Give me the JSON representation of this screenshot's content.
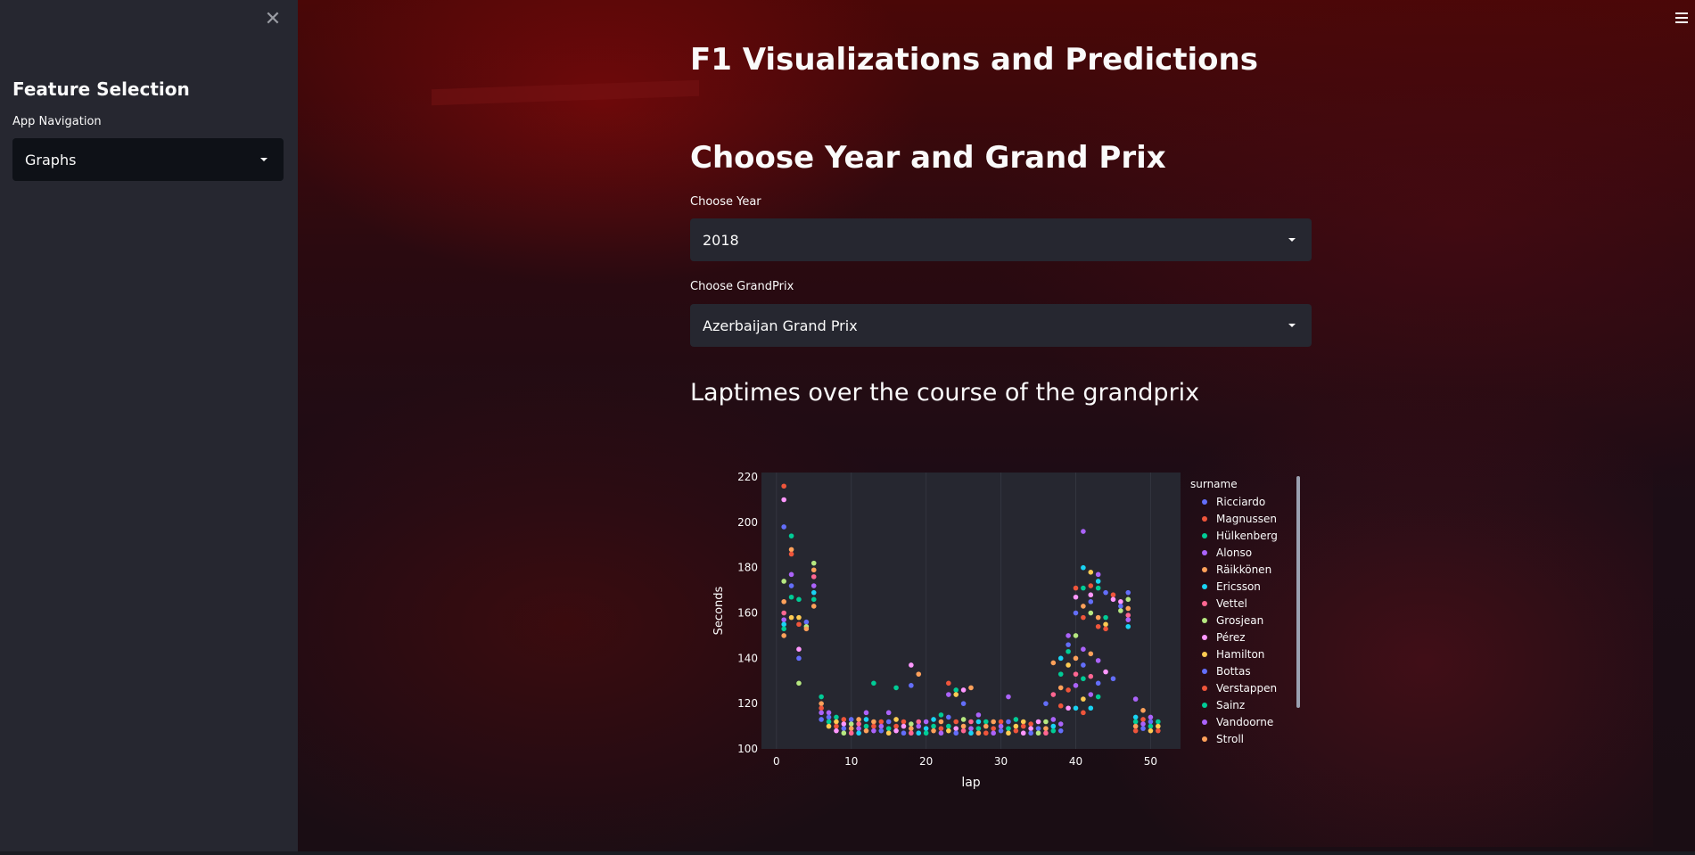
{
  "sidebar": {
    "close_icon": "close-icon",
    "title": "Feature Selection",
    "nav_label": "App Navigation",
    "nav_value": "Graphs"
  },
  "main": {
    "title": "F1 Visualizations and Predictions",
    "section_title": "Choose Year and Grand Prix",
    "year_label": "Choose Year",
    "year_value": "2018",
    "gp_label": "Choose GrandPrix",
    "gp_value": "Azerbaijan Grand Prix",
    "chart_heading": "Laptimes over the course of the grandprix",
    "menu_icon": "hamburger-menu-icon"
  },
  "colors": {
    "sidebar_bg": "#262730",
    "select_bg": "#262730",
    "plot_bg": "#262730"
  },
  "chart_data": {
    "type": "scatter",
    "xlabel": "lap",
    "ylabel": "Seconds",
    "xlim": [
      -2,
      54
    ],
    "ylim": [
      100,
      222
    ],
    "x_ticks": [
      0,
      10,
      20,
      30,
      40,
      50
    ],
    "y_ticks": [
      100,
      120,
      140,
      160,
      180,
      200,
      220
    ],
    "legend_title": "surname",
    "legend_position": "right",
    "series": [
      {
        "name": "Ricciardo",
        "color": "#636efa"
      },
      {
        "name": "Magnussen",
        "color": "#ef553b"
      },
      {
        "name": "Hülkenberg",
        "color": "#00cc96"
      },
      {
        "name": "Alonso",
        "color": "#ab63fa"
      },
      {
        "name": "Räikkönen",
        "color": "#ffa15a"
      },
      {
        "name": "Ericsson",
        "color": "#19d3f3"
      },
      {
        "name": "Vettel",
        "color": "#ff6692"
      },
      {
        "name": "Grosjean",
        "color": "#b6e880"
      },
      {
        "name": "Pérez",
        "color": "#ff97ff"
      },
      {
        "name": "Hamilton",
        "color": "#fecb52"
      },
      {
        "name": "Bottas",
        "color": "#636efa"
      },
      {
        "name": "Verstappen",
        "color": "#ef553b"
      },
      {
        "name": "Sainz",
        "color": "#00cc96"
      },
      {
        "name": "Vandoorne",
        "color": "#ab63fa"
      },
      {
        "name": "Stroll",
        "color": "#ffa15a"
      }
    ],
    "points": [
      [
        1,
        216
      ],
      [
        1,
        210
      ],
      [
        1,
        198
      ],
      [
        1,
        174
      ],
      [
        1,
        165
      ],
      [
        1,
        160
      ],
      [
        1,
        157
      ],
      [
        1,
        155
      ],
      [
        1,
        153
      ],
      [
        1,
        150
      ],
      [
        2,
        194
      ],
      [
        2,
        188
      ],
      [
        2,
        186
      ],
      [
        2,
        177
      ],
      [
        2,
        172
      ],
      [
        2,
        167
      ],
      [
        2,
        158
      ],
      [
        3,
        166
      ],
      [
        3,
        158
      ],
      [
        3,
        155
      ],
      [
        3,
        144
      ],
      [
        3,
        140
      ],
      [
        3,
        129
      ],
      [
        4,
        156
      ],
      [
        4,
        154
      ],
      [
        4,
        153
      ],
      [
        5,
        182
      ],
      [
        5,
        179
      ],
      [
        5,
        176
      ],
      [
        5,
        172
      ],
      [
        5,
        169
      ],
      [
        5,
        166
      ],
      [
        5,
        163
      ],
      [
        6,
        123
      ],
      [
        6,
        120
      ],
      [
        6,
        118
      ],
      [
        6,
        116
      ],
      [
        6,
        113
      ],
      [
        7,
        116
      ],
      [
        7,
        114
      ],
      [
        7,
        112
      ],
      [
        7,
        110
      ],
      [
        8,
        114
      ],
      [
        8,
        112
      ],
      [
        8,
        110
      ],
      [
        8,
        108
      ],
      [
        9,
        113
      ],
      [
        9,
        111
      ],
      [
        9,
        109
      ],
      [
        9,
        107
      ],
      [
        10,
        113
      ],
      [
        10,
        111
      ],
      [
        10,
        109
      ],
      [
        10,
        107
      ],
      [
        11,
        113
      ],
      [
        11,
        111
      ],
      [
        11,
        109
      ],
      [
        11,
        107
      ],
      [
        12,
        116
      ],
      [
        12,
        113
      ],
      [
        12,
        110
      ],
      [
        12,
        108
      ],
      [
        13,
        129
      ],
      [
        13,
        112
      ],
      [
        13,
        110
      ],
      [
        13,
        108
      ],
      [
        14,
        112
      ],
      [
        14,
        110
      ],
      [
        14,
        108
      ],
      [
        15,
        116
      ],
      [
        15,
        112
      ],
      [
        15,
        109
      ],
      [
        15,
        107
      ],
      [
        16,
        127
      ],
      [
        16,
        113
      ],
      [
        16,
        110
      ],
      [
        16,
        108
      ],
      [
        17,
        112
      ],
      [
        17,
        110
      ],
      [
        17,
        107
      ],
      [
        18,
        137
      ],
      [
        18,
        128
      ],
      [
        18,
        111
      ],
      [
        18,
        109
      ],
      [
        18,
        107
      ],
      [
        19,
        133
      ],
      [
        19,
        112
      ],
      [
        19,
        110
      ],
      [
        19,
        107
      ],
      [
        20,
        112
      ],
      [
        20,
        109
      ],
      [
        20,
        107
      ],
      [
        21,
        113
      ],
      [
        21,
        110
      ],
      [
        21,
        108
      ],
      [
        22,
        115
      ],
      [
        22,
        112
      ],
      [
        22,
        109
      ],
      [
        22,
        107
      ],
      [
        23,
        129
      ],
      [
        23,
        124
      ],
      [
        23,
        114
      ],
      [
        23,
        110
      ],
      [
        23,
        108
      ],
      [
        24,
        126
      ],
      [
        24,
        124
      ],
      [
        24,
        112
      ],
      [
        24,
        109
      ],
      [
        24,
        107
      ],
      [
        25,
        126
      ],
      [
        25,
        120
      ],
      [
        25,
        113
      ],
      [
        25,
        110
      ],
      [
        25,
        108
      ],
      [
        26,
        127
      ],
      [
        26,
        112
      ],
      [
        26,
        109
      ],
      [
        26,
        107
      ],
      [
        27,
        115
      ],
      [
        27,
        112
      ],
      [
        27,
        109
      ],
      [
        27,
        107
      ],
      [
        28,
        112
      ],
      [
        28,
        110
      ],
      [
        28,
        107
      ],
      [
        29,
        112
      ],
      [
        29,
        109
      ],
      [
        29,
        107
      ],
      [
        30,
        112
      ],
      [
        30,
        110
      ],
      [
        30,
        108
      ],
      [
        31,
        123
      ],
      [
        31,
        112
      ],
      [
        31,
        109
      ],
      [
        31,
        107
      ],
      [
        32,
        113
      ],
      [
        32,
        110
      ],
      [
        32,
        108
      ],
      [
        33,
        112
      ],
      [
        33,
        110
      ],
      [
        33,
        107
      ],
      [
        34,
        111
      ],
      [
        34,
        109
      ],
      [
        34,
        107
      ],
      [
        35,
        112
      ],
      [
        35,
        109
      ],
      [
        35,
        107
      ],
      [
        36,
        120
      ],
      [
        36,
        112
      ],
      [
        36,
        109
      ],
      [
        36,
        107
      ],
      [
        37,
        138
      ],
      [
        37,
        124
      ],
      [
        37,
        113
      ],
      [
        37,
        110
      ],
      [
        37,
        108
      ],
      [
        38,
        140
      ],
      [
        38,
        133
      ],
      [
        38,
        127
      ],
      [
        38,
        119
      ],
      [
        38,
        111
      ],
      [
        38,
        108
      ],
      [
        39,
        150
      ],
      [
        39,
        146
      ],
      [
        39,
        143
      ],
      [
        39,
        137
      ],
      [
        39,
        126
      ],
      [
        39,
        118
      ],
      [
        40,
        171
      ],
      [
        40,
        167
      ],
      [
        40,
        160
      ],
      [
        40,
        150
      ],
      [
        40,
        140
      ],
      [
        40,
        133
      ],
      [
        40,
        128
      ],
      [
        40,
        118
      ],
      [
        41,
        196
      ],
      [
        41,
        180
      ],
      [
        41,
        171
      ],
      [
        41,
        163
      ],
      [
        41,
        158
      ],
      [
        41,
        144
      ],
      [
        41,
        137
      ],
      [
        41,
        131
      ],
      [
        41,
        122
      ],
      [
        41,
        116
      ],
      [
        42,
        178
      ],
      [
        42,
        172
      ],
      [
        42,
        168
      ],
      [
        42,
        165
      ],
      [
        42,
        160
      ],
      [
        42,
        142
      ],
      [
        42,
        132
      ],
      [
        42,
        124
      ],
      [
        42,
        118
      ],
      [
        43,
        177
      ],
      [
        43,
        174
      ],
      [
        43,
        171
      ],
      [
        43,
        158
      ],
      [
        43,
        154
      ],
      [
        43,
        139
      ],
      [
        43,
        129
      ],
      [
        43,
        123
      ],
      [
        44,
        169
      ],
      [
        44,
        158
      ],
      [
        44,
        155
      ],
      [
        44,
        153
      ],
      [
        44,
        134
      ],
      [
        45,
        168
      ],
      [
        45,
        166
      ],
      [
        45,
        131
      ],
      [
        46,
        165
      ],
      [
        46,
        163
      ],
      [
        46,
        161
      ],
      [
        47,
        169
      ],
      [
        47,
        166
      ],
      [
        47,
        162
      ],
      [
        47,
        159
      ],
      [
        47,
        157
      ],
      [
        47,
        154
      ],
      [
        48,
        122
      ],
      [
        48,
        114
      ],
      [
        48,
        112
      ],
      [
        48,
        110
      ],
      [
        48,
        108
      ],
      [
        49,
        117
      ],
      [
        49,
        113
      ],
      [
        49,
        111
      ],
      [
        49,
        109
      ],
      [
        50,
        114
      ],
      [
        50,
        112
      ],
      [
        50,
        110
      ],
      [
        50,
        108
      ],
      [
        51,
        112
      ],
      [
        51,
        110
      ],
      [
        51,
        108
      ]
    ]
  }
}
